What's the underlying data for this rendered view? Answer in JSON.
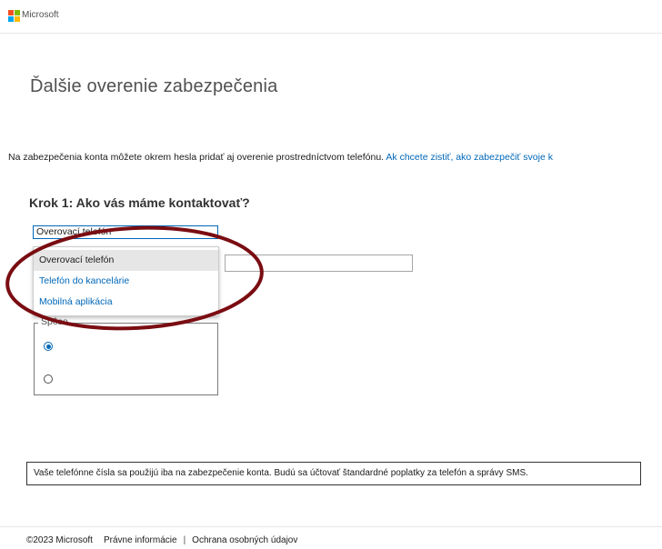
{
  "header": {
    "brand": "Microsoft"
  },
  "page_title": "Ďalšie overenie zabezpečenia",
  "intro": {
    "text": "Na zabezpečenia konta môžete okrem hesla pridať aj overenie prostredníctvom telefónu. ",
    "link": "Ak chcete zistiť, ako zabezpečiť svoje k"
  },
  "step": {
    "heading": "Krok 1: Ako vás máme kontaktovať?",
    "select_value": "Overovací telefón",
    "options": [
      "Overovací telefón",
      "Telefón do kancelárie",
      "Mobilná aplikácia"
    ],
    "method_legend": "Spôso",
    "phone_value": ""
  },
  "notice": "Vaše telefónne čísla sa použijú iba na zabezpečenie konta. Budú sa účtovať štandardné poplatky za telefón a správy SMS.",
  "footer": {
    "copyright": "©2023 Microsoft",
    "legal": "Právne informácie",
    "separator": "|",
    "privacy": "Ochrana osobných údajov"
  },
  "colors": {
    "link": "#0067b8",
    "annotation": "#7a0d12"
  }
}
